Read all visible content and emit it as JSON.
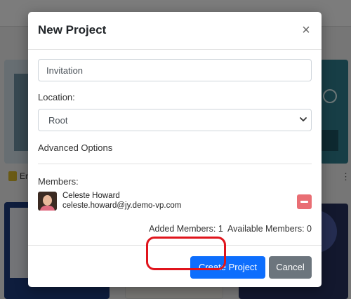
{
  "background": {
    "card_label": "Er"
  },
  "modal": {
    "title": "New Project",
    "close_glyph": "×",
    "name_input": {
      "value": "Invitation",
      "placeholder": ""
    },
    "location_label": "Location:",
    "location_value": "Root",
    "advanced_options": "Advanced Options",
    "members_label": "Members:",
    "members": [
      {
        "name": "Celeste Howard",
        "email": "celeste.howard@jy.demo-vp.com"
      }
    ],
    "added_members_text": "Added Members: 1",
    "available_members_text": "Available Members: 0",
    "create_label": "Create Project",
    "cancel_label": "Cancel"
  },
  "colors": {
    "primary": "#0d6efd",
    "secondary": "#6c757d",
    "danger": "#e96e74",
    "highlight": "#e0141c"
  },
  "icons": {
    "close": "close-icon",
    "select_chevron": "chevron-down-icon",
    "remove_member": "minus-icon",
    "document": "document-icon",
    "more": "more-vertical-icon"
  }
}
